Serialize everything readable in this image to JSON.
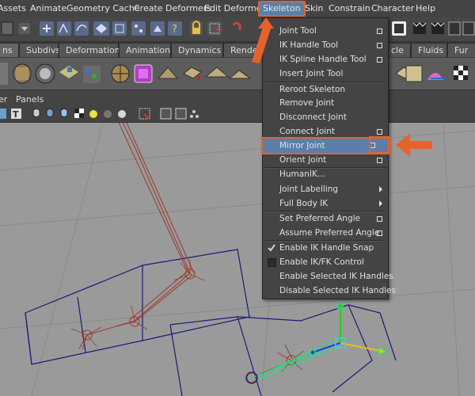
{
  "menubar": {
    "items": [
      "Assets",
      "Animate",
      "Geometry Cache",
      "Create Deformers",
      "Edit Deformers",
      "Skeleton",
      "Skin",
      "Constrain",
      "Character",
      "Help"
    ]
  },
  "shelf_tabs": {
    "items": [
      "ns",
      "Subdivs",
      "Deformation",
      "Animation",
      "Dynamics",
      "Render",
      "cle",
      "Fluids",
      "Fur"
    ]
  },
  "panel_menu": {
    "items": [
      "er",
      "Panels"
    ]
  },
  "skeleton_menu": {
    "items": [
      {
        "label": "Joint Tool",
        "option_box": true
      },
      {
        "label": "IK Handle Tool",
        "option_box": true
      },
      {
        "label": "IK Spline Handle Tool",
        "option_box": true
      },
      {
        "label": "Insert Joint Tool",
        "option_box": false
      },
      {
        "label": "Reroot Skeleton",
        "option_box": false
      },
      {
        "label": "Remove Joint",
        "option_box": false
      },
      {
        "label": "Disconnect Joint",
        "option_box": false
      },
      {
        "label": "Connect Joint",
        "option_box": true
      },
      {
        "label": "Mirror Joint",
        "option_box": true
      },
      {
        "label": "Orient Joint",
        "option_box": true
      },
      {
        "label": "HumanIK...",
        "option_box": false
      },
      {
        "label": "Joint Labelling",
        "submenu": true
      },
      {
        "label": "Full Body IK",
        "submenu": true
      },
      {
        "label": "Set Preferred Angle",
        "option_box": true
      },
      {
        "label": "Assume Preferred Angle",
        "option_box": true
      },
      {
        "label": "Enable IK Handle Snap",
        "checked": true
      },
      {
        "label": "Enable IK/FK Control",
        "checked": false
      },
      {
        "label": "Enable Selected IK Handles",
        "option_box": false
      },
      {
        "label": "Disable Selected IK Handles",
        "option_box": false
      }
    ]
  },
  "colors": {
    "accent_orange": "#e8612c",
    "highlight_blue": "#5a7faa",
    "viewport_bg": "#9a9a9a",
    "wire_blue": "#1a1a7a",
    "bone_red": "#9a3a2a",
    "ik_green": "#20e080"
  }
}
